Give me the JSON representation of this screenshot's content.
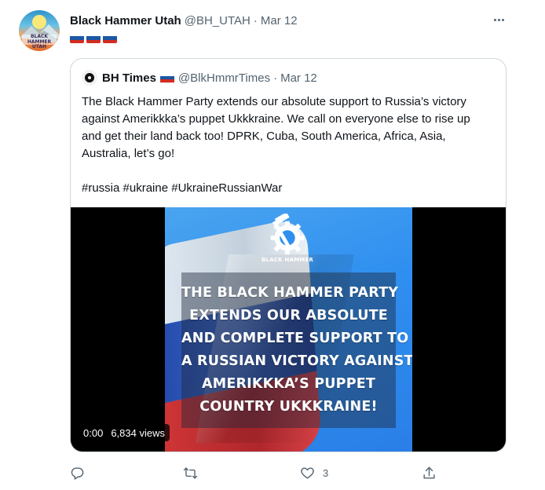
{
  "author": {
    "name": "Black Hammer Utah",
    "handle": "@BH_UTAH",
    "separator": "·",
    "date": "Mar 12",
    "avatar_text": "BLACK HAMMER UTAH",
    "flags": [
      "russia-flag",
      "russia-flag",
      "russia-flag"
    ]
  },
  "quoted": {
    "name": "BH Times",
    "handle": "@BlkHmmrTimes",
    "separator": "·",
    "date": "Mar 12",
    "text": "The Black Hammer Party extends our absolute support to Russia’s victory against Amerikkka’s puppet Ukkkraine. We call on everyone else to rise up and get their land back too! DPRK, Cuba, South America, Africa, Asia, Australia, let’s go!",
    "hashtags": "#russia #ukraine #UkraineRussianWar",
    "media": {
      "logo_label": "BLACK HAMMER",
      "headline_lines": [
        "THE BLACK HAMMER PARTY",
        "EXTENDS OUR ABSOLUTE",
        "AND COMPLETE SUPPORT TO",
        "A RUSSIAN VICTORY AGAINST",
        "AMERIKKKA’S PUPPET",
        "COUNTRY UKKKRAINE!"
      ],
      "time": "0:00",
      "views": "6,834 views"
    }
  },
  "actions": {
    "reply_icon": "reply-icon",
    "retweet_icon": "retweet-icon",
    "like_icon": "heart-icon",
    "like_count": "3",
    "share_icon": "share-icon"
  },
  "colors": {
    "text_primary": "#0f1419",
    "text_secondary": "#536471",
    "border": "#cfd9de"
  }
}
